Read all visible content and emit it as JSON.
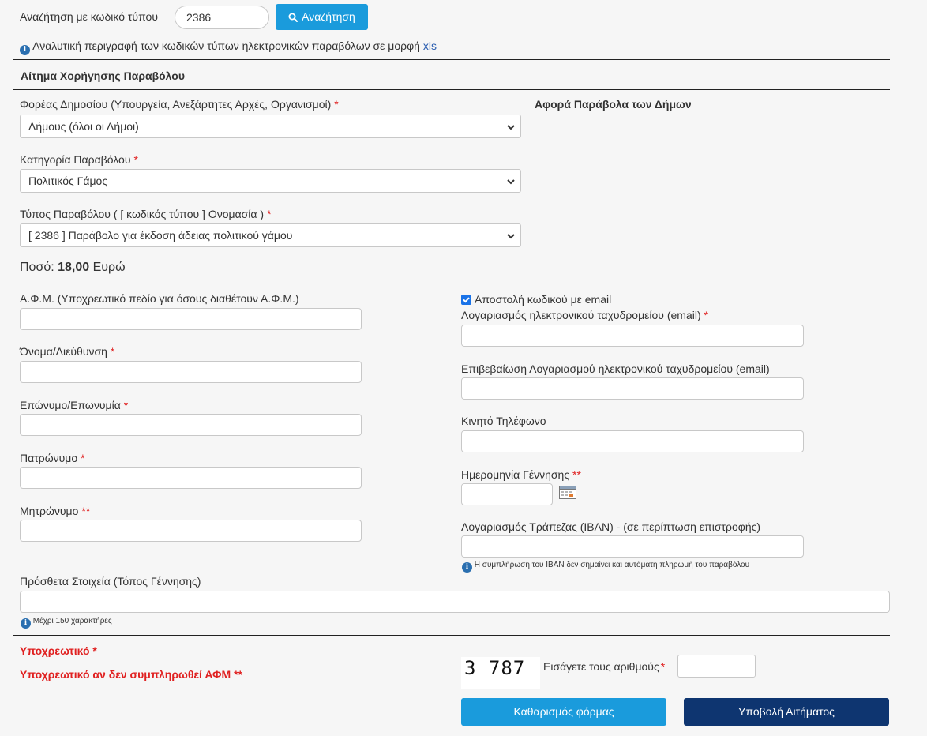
{
  "search": {
    "label": "Αναζήτηση με κωδικό τύπου",
    "value": "2386",
    "button_label": "Αναζήτηση"
  },
  "info_line": {
    "text": "Αναλυτική περιγραφή των κωδικών τύπων ηλεκτρονικών παραβόλων σε μορφή",
    "link": "xls"
  },
  "section_title": "Αίτημα Χορήγησης Παραβόλου",
  "right_note": "Αφορά Παράβολα των Δήμων",
  "fields": {
    "foreas": {
      "label": "Φορέας Δημοσίου (Υπουργεία, Ανεξάρτητες Αρχές, Οργανισμοί)",
      "req": "*",
      "value": "Δήμους (όλοι οι Δήμοι)"
    },
    "category": {
      "label": "Κατηγορία Παραβόλου",
      "req": "*",
      "value": "Πολιτικός Γάμος"
    },
    "type": {
      "label": "Τύπος Παραβόλου ( [ κωδικός τύπου ] Ονομασία )",
      "req": "*",
      "value": "[ 2386 ] Παράβολο για έκδοση άδειας πολιτικού γάμου"
    }
  },
  "amount": {
    "label": "Ποσό:",
    "value": "18,00",
    "currency": "Ευρώ"
  },
  "left_fields": [
    {
      "label": "Α.Φ.Μ. (Υποχρεωτικό πεδίο για όσους διαθέτουν Α.Φ.Μ.)",
      "req": ""
    },
    {
      "label": "Όνομα/Διεύθυνση",
      "req": "*"
    },
    {
      "label": "Επώνυμο/Επωνυμία",
      "req": "*"
    },
    {
      "label": "Πατρώνυμο",
      "req": "*"
    },
    {
      "label": "Μητρώνυμο",
      "req": "**"
    }
  ],
  "email_checkbox": {
    "label": "Αποστολή κωδικού με email",
    "checked": true
  },
  "right_fields": {
    "email": {
      "label": "Λογαριασμός ηλεκτρονικού ταχυδρομείου (email)",
      "req": "*"
    },
    "email_confirm": {
      "label": "Επιβεβαίωση Λογαριασμού ηλεκτρονικού ταχυδρομείου (email)",
      "req": ""
    },
    "mobile": {
      "label": "Κινητό Τηλέφωνο",
      "req": ""
    },
    "birthdate": {
      "label": "Ημερομηνία Γέννησης",
      "req": "**"
    },
    "iban": {
      "label": "Λογαριασμός Τράπεζας (IBAN) - (σε περίπτωση επιστροφής)",
      "req": "",
      "note": "Η συμπλήρωση του IBAN δεν σημαίνει και αυτόματη πληρωμή του παραβόλου"
    }
  },
  "extra": {
    "label": "Πρόσθετα Στοιχεία (Τόπος Γέννησης)",
    "note": "Μέχρι 150 χαρακτήρες"
  },
  "legend": {
    "required": "Υποχρεωτικό *",
    "required_if_no_afm": "Υποχρεωτικό αν δεν συμπληρωθεί ΑΦΜ **"
  },
  "captcha": {
    "digits": "3 787",
    "prompt": "Εισάγετε τους αριθμούς",
    "req": "*"
  },
  "buttons": {
    "clear": "Καθαρισμός φόρμας",
    "submit": "Υποβολή Αιτήματος"
  },
  "colors": {
    "primary_button": "#1a9bdc",
    "submit_button": "#0e3570",
    "required": "#e02020",
    "link": "#2a5db0"
  }
}
